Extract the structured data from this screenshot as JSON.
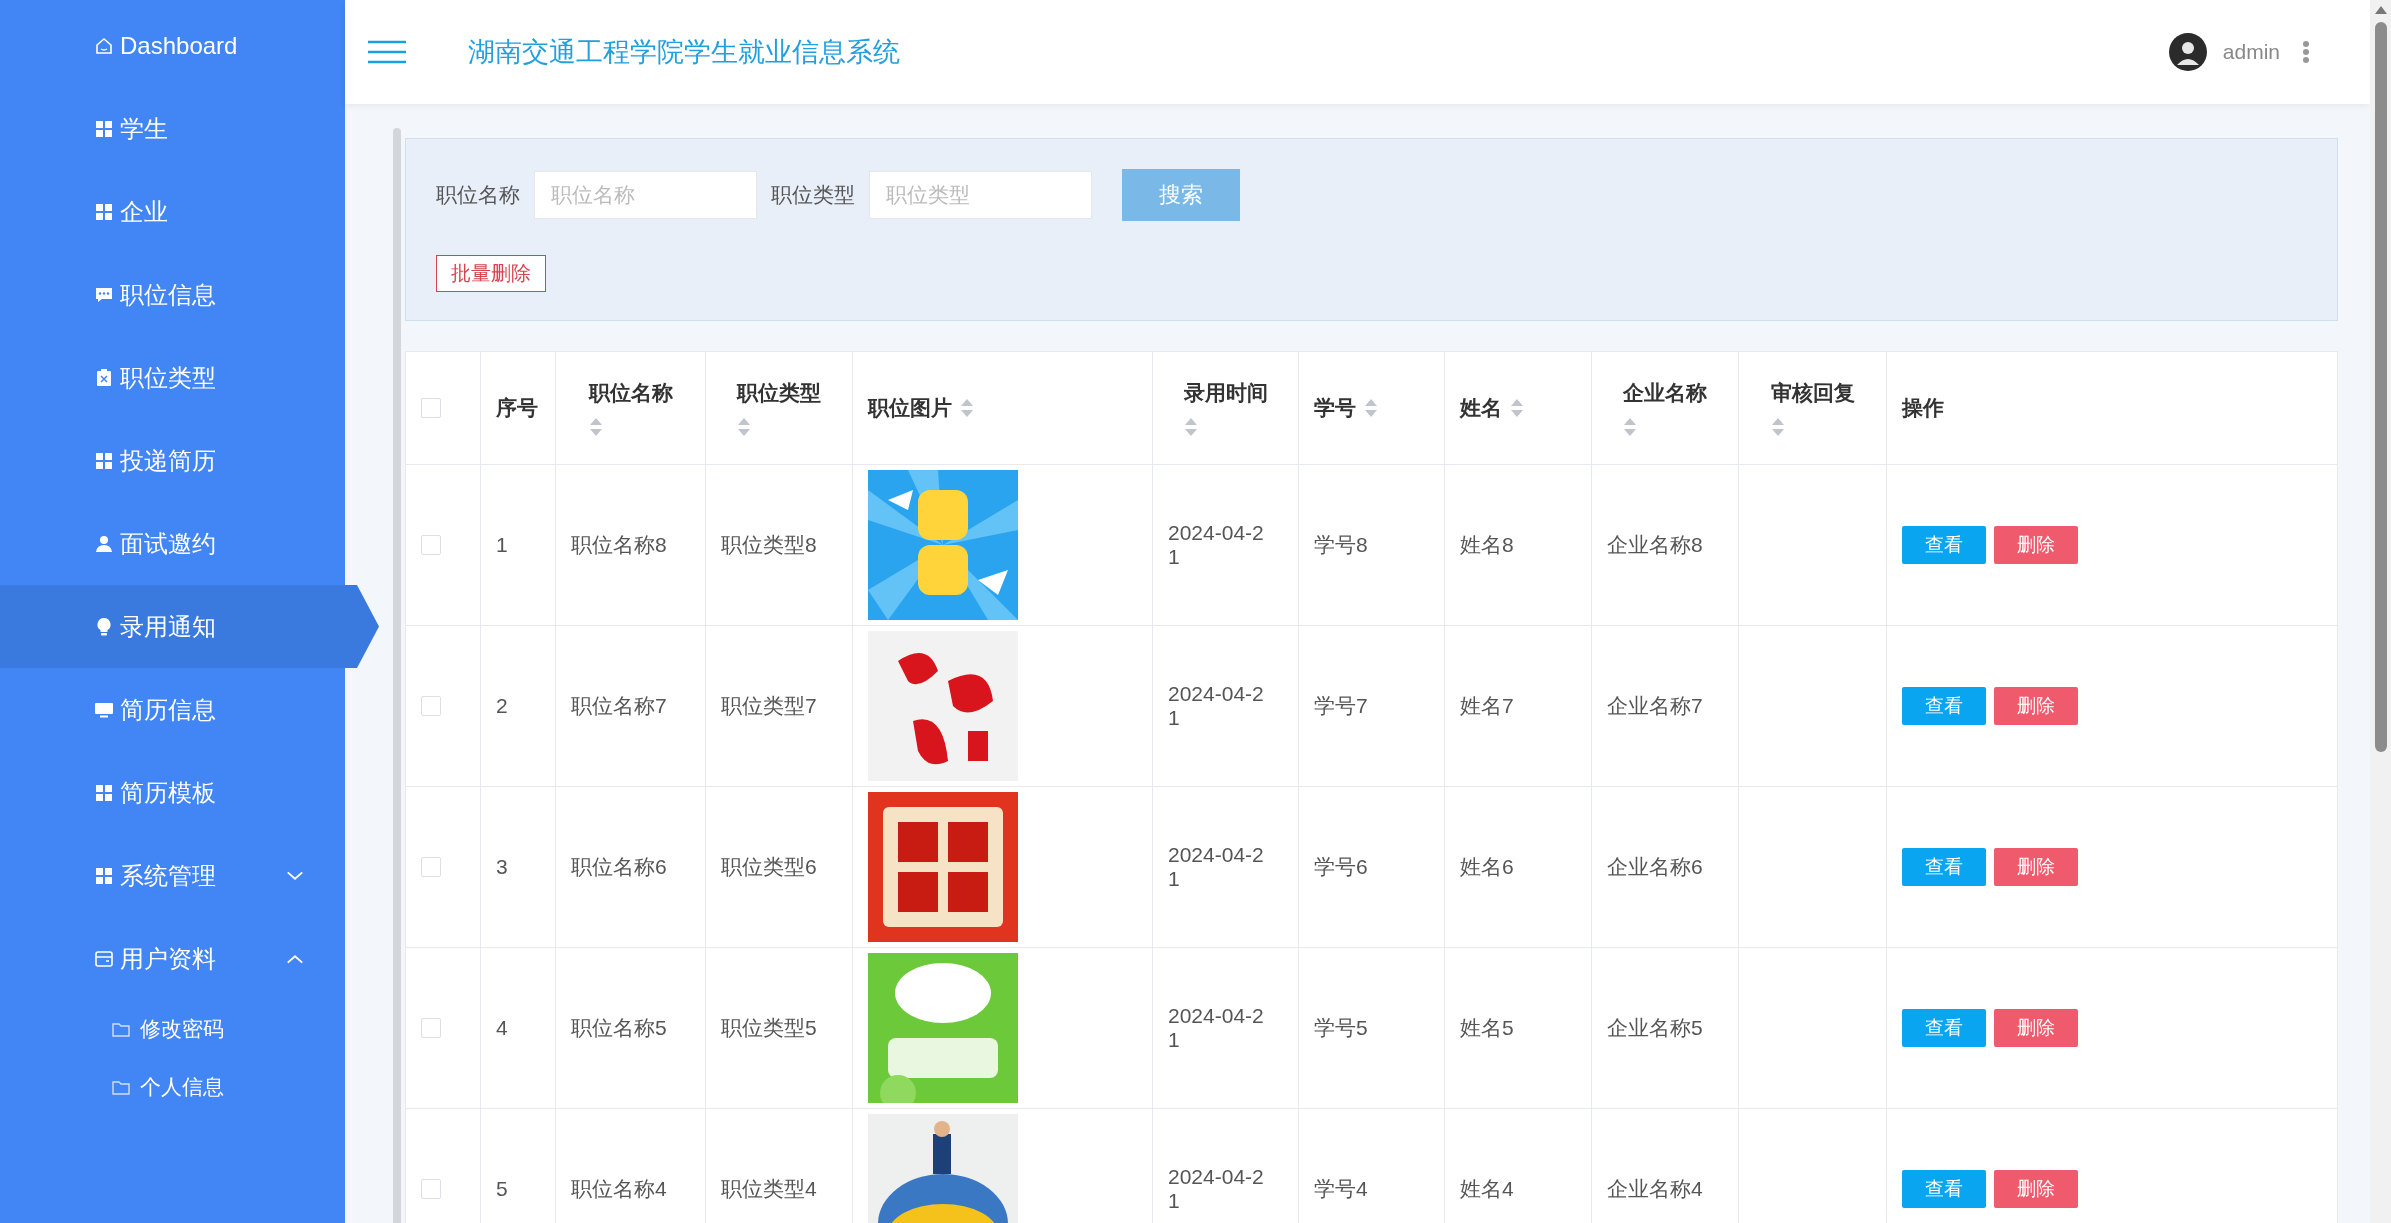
{
  "sidebar": {
    "items": [
      {
        "label": "Dashboard",
        "selected": false
      },
      {
        "label": "学生",
        "selected": false
      },
      {
        "label": "企业",
        "selected": false
      },
      {
        "label": "职位信息",
        "selected": false
      },
      {
        "label": "职位类型",
        "selected": false
      },
      {
        "label": "投递简历",
        "selected": false
      },
      {
        "label": "面试邀约",
        "selected": false
      },
      {
        "label": "录用通知",
        "selected": true
      },
      {
        "label": "简历信息",
        "selected": false
      },
      {
        "label": "简历模板",
        "selected": false
      },
      {
        "label": "系统管理",
        "selected": false,
        "expanded": false
      },
      {
        "label": "用户资料",
        "selected": false,
        "expanded": true,
        "children": [
          {
            "label": "修改密码"
          },
          {
            "label": "个人信息"
          }
        ]
      }
    ]
  },
  "header": {
    "title": "湖南交通工程学院学生就业信息系统",
    "user": "admin"
  },
  "filter": {
    "fields": [
      {
        "label": "职位名称",
        "placeholder": "职位名称"
      },
      {
        "label": "职位类型",
        "placeholder": "职位类型"
      }
    ],
    "search_button": "搜索",
    "batch_delete_button": "批量删除"
  },
  "table": {
    "select_all_checked": false,
    "columns": [
      {
        "label": "序号",
        "sortable": false
      },
      {
        "label": "职位名称",
        "sortable": true
      },
      {
        "label": "职位类型",
        "sortable": true
      },
      {
        "label": "职位图片",
        "sortable": true
      },
      {
        "label": "录用时间",
        "sortable": true
      },
      {
        "label": "学号",
        "sortable": true
      },
      {
        "label": "姓名",
        "sortable": true
      },
      {
        "label": "企业名称",
        "sortable": true
      },
      {
        "label": "审核回复",
        "sortable": true
      },
      {
        "label": "操作",
        "sortable": false
      }
    ],
    "rows": [
      {
        "checked": false,
        "cells": [
          "1",
          "职位名称8",
          "职位类型8",
          "",
          "2024-04-21",
          "学号8",
          "姓名8",
          "企业名称8",
          ""
        ],
        "actions": [
          "查看",
          "删除"
        ]
      },
      {
        "checked": false,
        "cells": [
          "2",
          "职位名称7",
          "职位类型7",
          "",
          "2024-04-21",
          "学号7",
          "姓名7",
          "企业名称7",
          ""
        ],
        "actions": [
          "查看",
          "删除"
        ]
      },
      {
        "checked": false,
        "cells": [
          "3",
          "职位名称6",
          "职位类型6",
          "",
          "2024-04-21",
          "学号6",
          "姓名6",
          "企业名称6",
          ""
        ],
        "actions": [
          "查看",
          "删除"
        ]
      },
      {
        "checked": false,
        "cells": [
          "4",
          "职位名称5",
          "职位类型5",
          "",
          "2024-04-21",
          "学号5",
          "姓名5",
          "企业名称5",
          ""
        ],
        "actions": [
          "查看",
          "删除"
        ]
      },
      {
        "checked": false,
        "cells": [
          "5",
          "职位名称4",
          "职位类型4",
          "",
          "2024-04-21",
          "学号4",
          "姓名4",
          "企业名称4",
          ""
        ],
        "actions": [
          "查看",
          "删除"
        ]
      }
    ]
  }
}
